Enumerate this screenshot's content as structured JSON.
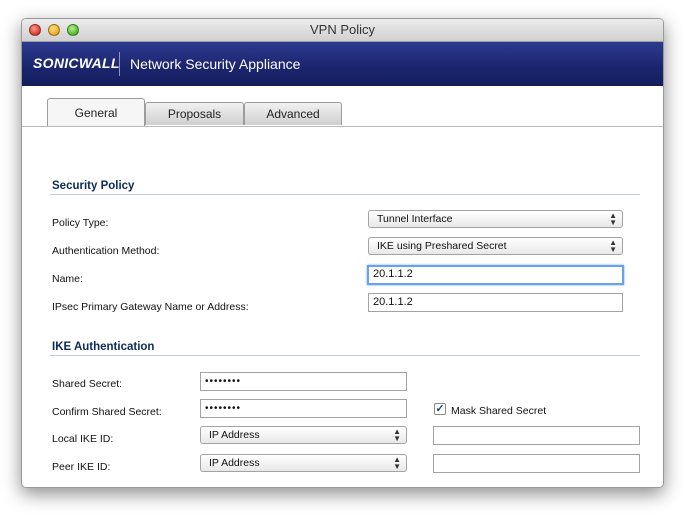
{
  "window": {
    "title": "VPN Policy"
  },
  "banner": {
    "logo": "SONICWALL",
    "app_name": "Network Security Appliance"
  },
  "tabs": [
    {
      "label": "General",
      "active": true
    },
    {
      "label": "Proposals",
      "active": false
    },
    {
      "label": "Advanced",
      "active": false
    }
  ],
  "security_policy": {
    "heading": "Security Policy",
    "policy_type": {
      "label": "Policy Type:",
      "value": "Tunnel Interface"
    },
    "auth_method": {
      "label": "Authentication Method:",
      "value": "IKE using Preshared Secret"
    },
    "name": {
      "label": "Name:",
      "value": "20.1.1.2"
    },
    "gateway": {
      "label": "IPsec Primary Gateway Name or Address:",
      "value": "20.1.1.2"
    }
  },
  "ike_auth": {
    "heading": "IKE Authentication",
    "shared_secret": {
      "label": "Shared Secret:",
      "value": "••••••••"
    },
    "confirm_secret": {
      "label": "Confirm Shared Secret:",
      "value": "••••••••"
    },
    "mask_secret": {
      "label": "Mask Shared Secret",
      "checked": true
    },
    "local_ike_id": {
      "label": "Local IKE ID:",
      "type": "IP Address",
      "value": ""
    },
    "peer_ike_id": {
      "label": "Peer IKE ID:",
      "type": "IP Address",
      "value": ""
    }
  },
  "icons": {
    "select_arrows": "up-down-arrows-icon",
    "check": "checkmark-icon"
  },
  "colors": {
    "banner": "#1c2670",
    "focus": "#6aa2ea",
    "section_heading": "#0c2a5a"
  }
}
